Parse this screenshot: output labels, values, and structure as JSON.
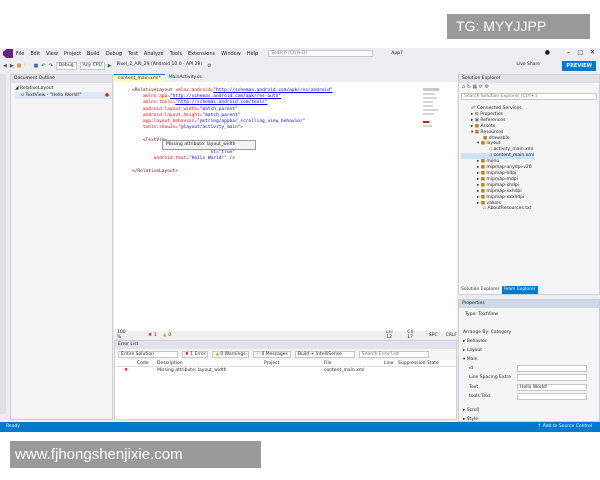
{
  "watermark_top": "TG: MYYJJPP",
  "watermark_bottom": "www.fjhongshenjixie.com",
  "menu": [
    "File",
    "Edit",
    "View",
    "Project",
    "Build",
    "Debug",
    "Test",
    "Analyze",
    "Tools",
    "Extensions",
    "Window",
    "Help"
  ],
  "search_placeholder": "Search (Ctrl+Q)",
  "app_title": "App7",
  "toolbar": {
    "config": "Debug",
    "platform": "Any CPU",
    "device": "Pixel_2_API_29 (Android 10.0 - API 29)",
    "live_share": "Live Share",
    "preview": "PREVIEW"
  },
  "doc_outline": {
    "title": "Document Outline",
    "items": [
      "RelativeLayout",
      "TextView - \"Hello World!\""
    ]
  },
  "tabs": [
    "content_main.xml*",
    "MainActivity.cs"
  ],
  "code": {
    "l1a": "<RelativeLayout ",
    "l1b": "xmlns:android=",
    "l1c": "\"http://schemas.android.com/apk/res/android\"",
    "l2a": "    xmlns:app=",
    "l2b": "\"http://schemas.android.com/apk/res-auto\"",
    "l3a": "    xmlns:tools=",
    "l3b": "\"http://schemas.android.com/tools\"",
    "l4a": "    android:layout_width=",
    "l4b": "\"match_parent\"",
    "l5a": "    android:layout_height=",
    "l5b": "\"match_parent\"",
    "l6a": "    app:layout_behavior=",
    "l6b": "\"@string/appbar_scrolling_view_behavior\"",
    "l7a": "    tools:showIn=",
    "l7b": "\"@layout/activity_main\"",
    "l7c": ">",
    "l9": "    <TextView",
    "l10b": "\"content\"",
    "l11b": "nt=\"true\"",
    "l12a": "        android:text=",
    "l12b": "\"Hello World!\"",
    "l12c": " />",
    "l14": "</RelativeLayout>"
  },
  "tooltip": "Missing attribute: layout_width",
  "editor_status": {
    "zoom": "100 %",
    "errors": "1",
    "warnings": "0",
    "ln": "Ln: 12",
    "ch": "Ch: 17",
    "spc": "SPC",
    "crlf": "CRLF"
  },
  "error_list": {
    "title": "Error List",
    "scope": "Entire Solution",
    "errors": "1 Error",
    "warnings": "0 Warnings",
    "messages": "0 Messages",
    "build": "Build + IntelliSense",
    "search": "Search Error List",
    "headers": [
      "Code",
      "Description",
      "Project",
      "File",
      "Line",
      "Suppression State"
    ],
    "rows": [
      {
        "desc": "Missing attribute: layout_width",
        "file": "content_main.xml"
      }
    ]
  },
  "solution_explorer": {
    "title": "Solution Explorer",
    "search": "Search Solution Explorer (Ctrl+;)",
    "tree": [
      "Connected Services",
      "Properties",
      "References",
      "Assets",
      "Resources",
      "drawable",
      "layout",
      "activity_main.xml",
      "content_main.xml",
      "menu",
      "mipmap-anydpi-v26",
      "mipmap-hdpi",
      "mipmap-mdpi",
      "mipmap-xhdpi",
      "mipmap-xxhdpi",
      "mipmap-xxxhdpi",
      "values",
      "AboutResources.txt"
    ],
    "tabs": [
      "Solution Explorer",
      "Team Explorer"
    ]
  },
  "properties": {
    "title": "Properties",
    "type": "Type: TextView",
    "arrange": "Arrange By: Category",
    "sections": [
      "Behavior",
      "Layout",
      "Main",
      "Scroll",
      "Style"
    ],
    "fields": [
      "id",
      "Line Spacing Extra",
      "Text",
      "tools:Text"
    ],
    "text_value": "Hello World!"
  },
  "status": {
    "left": "Ready",
    "right": "Add to Source Control"
  },
  "colors": {
    "accent": "#007acc",
    "vs_purple": "#68217a",
    "error": "#e51400"
  }
}
